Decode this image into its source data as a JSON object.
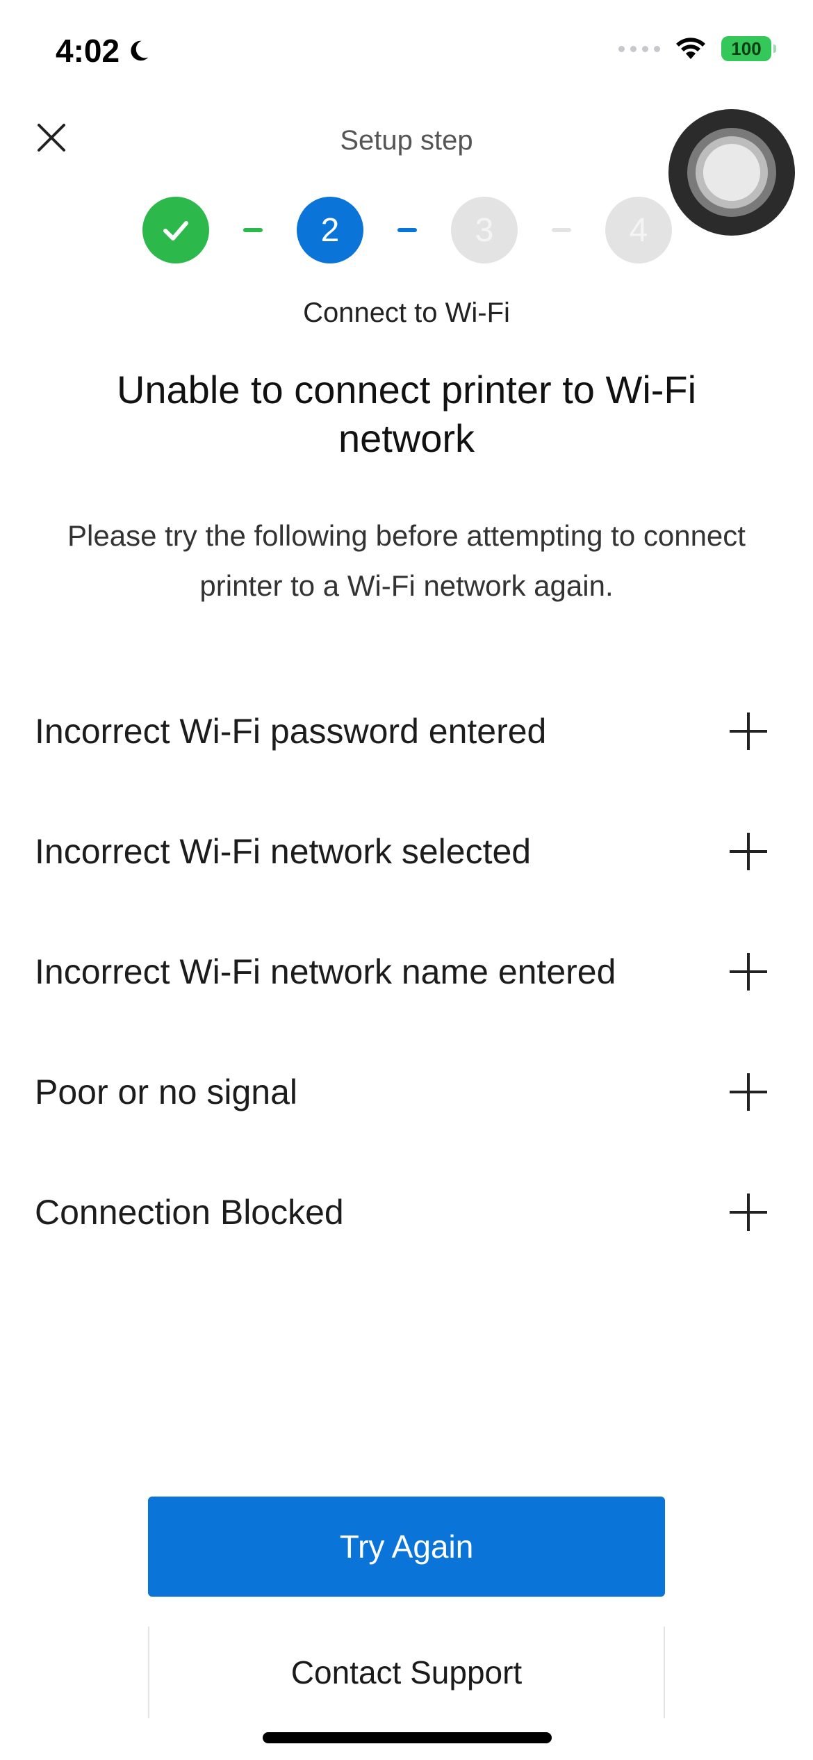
{
  "status_bar": {
    "time": "4:02",
    "battery": "100",
    "battery_color": "#34c759"
  },
  "header": {
    "close_icon": "close-x-icon",
    "title": "Setup step"
  },
  "stepper": {
    "current_step": 2,
    "total_steps": 4,
    "steps": [
      {
        "label": "",
        "state": "completed",
        "icon": "checkmark-icon"
      },
      {
        "label": "2",
        "state": "active"
      },
      {
        "label": "3",
        "state": "pending"
      },
      {
        "label": "4",
        "state": "pending"
      }
    ],
    "caption": "Connect to Wi-Fi",
    "colors": {
      "completed": "#2db84b",
      "active": "#0a74d8",
      "pending": "#e3e3e3"
    }
  },
  "main": {
    "title": "Unable to connect printer to Wi-Fi network",
    "description": "Please try the following before attempting to connect printer to a Wi-Fi network again."
  },
  "issues": [
    {
      "label": "Incorrect Wi-Fi password entered",
      "icon": "plus-icon"
    },
    {
      "label": "Incorrect Wi-Fi network selected",
      "icon": "plus-icon"
    },
    {
      "label": "Incorrect Wi-Fi network name entered",
      "icon": "plus-icon"
    },
    {
      "label": "Poor or no signal",
      "icon": "plus-icon"
    },
    {
      "label": "Connection Blocked",
      "icon": "plus-icon"
    }
  ],
  "actions": {
    "primary_label": "Try Again",
    "secondary_label": "Contact Support",
    "accent_color": "#0a74d8"
  }
}
